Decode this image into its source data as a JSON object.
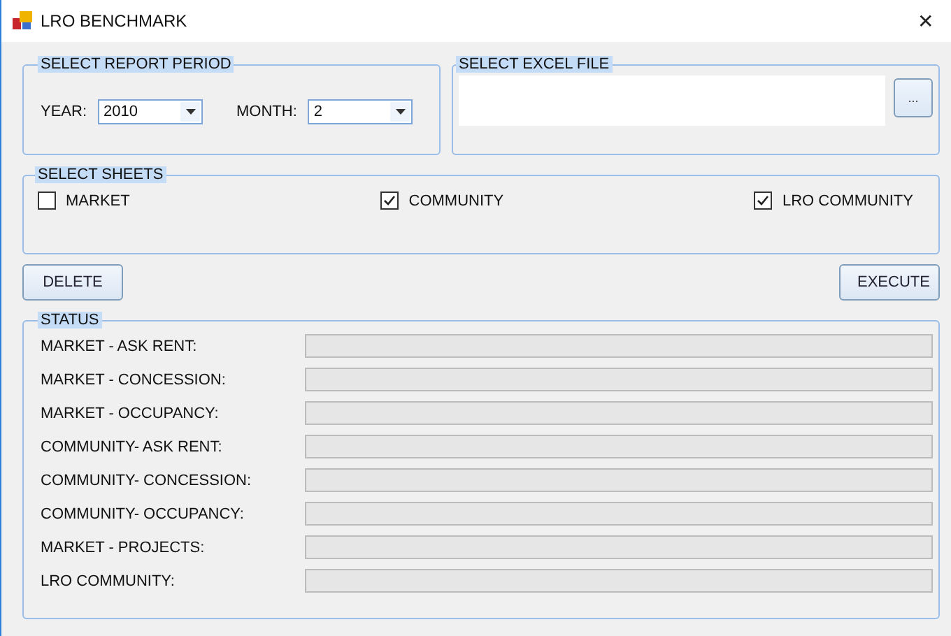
{
  "window": {
    "title": "LRO BENCHMARK",
    "close": "✕"
  },
  "report_period": {
    "title": "SELECT REPORT PERIOD",
    "year_label": "YEAR:",
    "year": "2010",
    "month_label": "MONTH:",
    "month": "2"
  },
  "excel_file": {
    "title": "SELECT EXCEL FILE",
    "browse_button": "..."
  },
  "sheets": {
    "title": "SELECT SHEETS",
    "items": [
      {
        "label": "MARKET",
        "checked": false
      },
      {
        "label": "COMMUNITY",
        "checked": true
      },
      {
        "label": "LRO COMMUNITY",
        "checked": true
      }
    ]
  },
  "buttons": {
    "delete": "DELETE",
    "execute": "EXECUTE"
  },
  "status": {
    "title": "STATUS",
    "rows": [
      {
        "label": "MARKET - ASK RENT:",
        "level": 0
      },
      {
        "label": "MARKET - CONCESSION:",
        "level": 0
      },
      {
        "label": "MARKET - OCCUPANCY:",
        "level": 0
      },
      {
        "label": "COMMUNITY- ASK RENT:",
        "level": 0
      },
      {
        "label": "COMMUNITY- CONCESSION:",
        "level": 0
      },
      {
        "label": "COMMUNITY- OCCUPANCY:",
        "level": 0
      },
      {
        "label": "MARKET - PROJECTS:",
        "level": 0
      },
      {
        "label": "LRO COMMUNITY:",
        "level": 0
      }
    ]
  }
}
